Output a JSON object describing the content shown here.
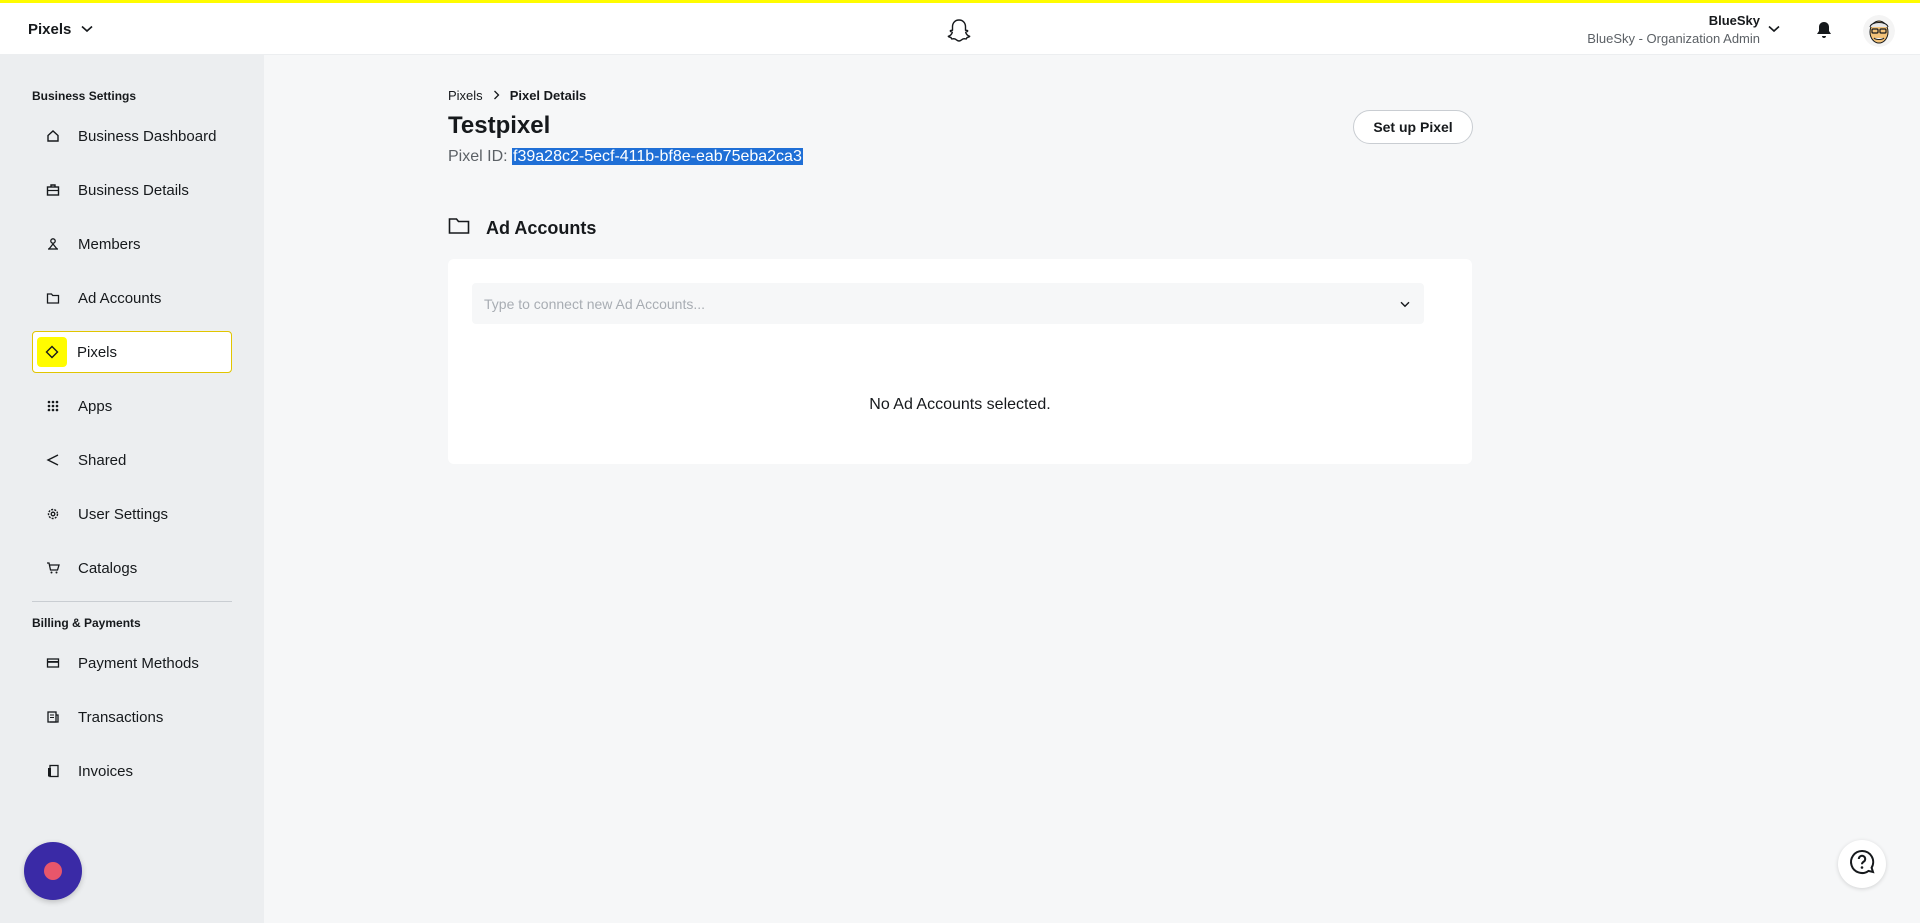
{
  "header": {
    "app_switcher_label": "Pixels",
    "account_name": "BlueSky",
    "account_role": "BlueSky - Organization Admin"
  },
  "sidebar": {
    "business_settings_title": "Business Settings",
    "items": [
      {
        "label": "Business Dashboard",
        "icon": "home-icon"
      },
      {
        "label": "Business Details",
        "icon": "briefcase-icon"
      },
      {
        "label": "Members",
        "icon": "members-icon"
      },
      {
        "label": "Ad Accounts",
        "icon": "folder-icon"
      },
      {
        "label": "Pixels",
        "icon": "diamond-icon",
        "active": true
      },
      {
        "label": "Apps",
        "icon": "grid-icon"
      },
      {
        "label": "Shared",
        "icon": "share-icon"
      },
      {
        "label": "User Settings",
        "icon": "gear-icon"
      },
      {
        "label": "Catalogs",
        "icon": "cart-icon"
      }
    ],
    "billing_title": "Billing & Payments",
    "billing_items": [
      {
        "label": "Payment Methods",
        "icon": "credit-card-icon"
      },
      {
        "label": "Transactions",
        "icon": "receipt-icon"
      },
      {
        "label": "Invoices",
        "icon": "invoice-icon"
      }
    ]
  },
  "breadcrumb": {
    "parent": "Pixels",
    "current": "Pixel Details"
  },
  "page": {
    "title": "Testpixel",
    "pixel_id_label": "Pixel ID:",
    "pixel_id_value": "f39a28c2-5ecf-411b-bf8e-eab75eba2ca3",
    "setup_button": "Set up Pixel"
  },
  "ad_accounts": {
    "heading": "Ad Accounts",
    "input_placeholder": "Type to connect new Ad Accounts...",
    "empty_message": "No Ad Accounts selected."
  },
  "colors": {
    "accent_yellow": "#fffc00",
    "selection_blue": "#1f6fd6",
    "chat_purple": "#3a2aa6"
  }
}
